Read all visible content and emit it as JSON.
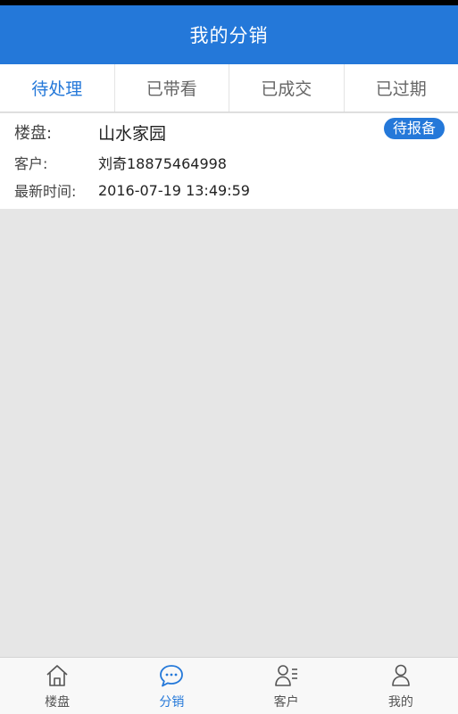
{
  "header": {
    "title": "我的分销"
  },
  "tabs": [
    {
      "label": "待处理"
    },
    {
      "label": "已带看"
    },
    {
      "label": "已成交"
    },
    {
      "label": "已过期"
    }
  ],
  "record": {
    "property_label": "楼盘:",
    "property_value": "山水家园",
    "status_badge": "待报备",
    "customer_label": "客户:",
    "customer_value": "刘奇18875464998",
    "time_label": "最新时间:",
    "time_value": "2016-07-19 13:49:59"
  },
  "bottom_nav": [
    {
      "label": "楼盘",
      "icon": "home-icon"
    },
    {
      "label": "分销",
      "icon": "chat-bubble-icon"
    },
    {
      "label": "客户",
      "icon": "customer-list-icon"
    },
    {
      "label": "我的",
      "icon": "person-icon"
    }
  ],
  "colors": {
    "accent": "#2478d9",
    "background": "#e6e6e6"
  }
}
